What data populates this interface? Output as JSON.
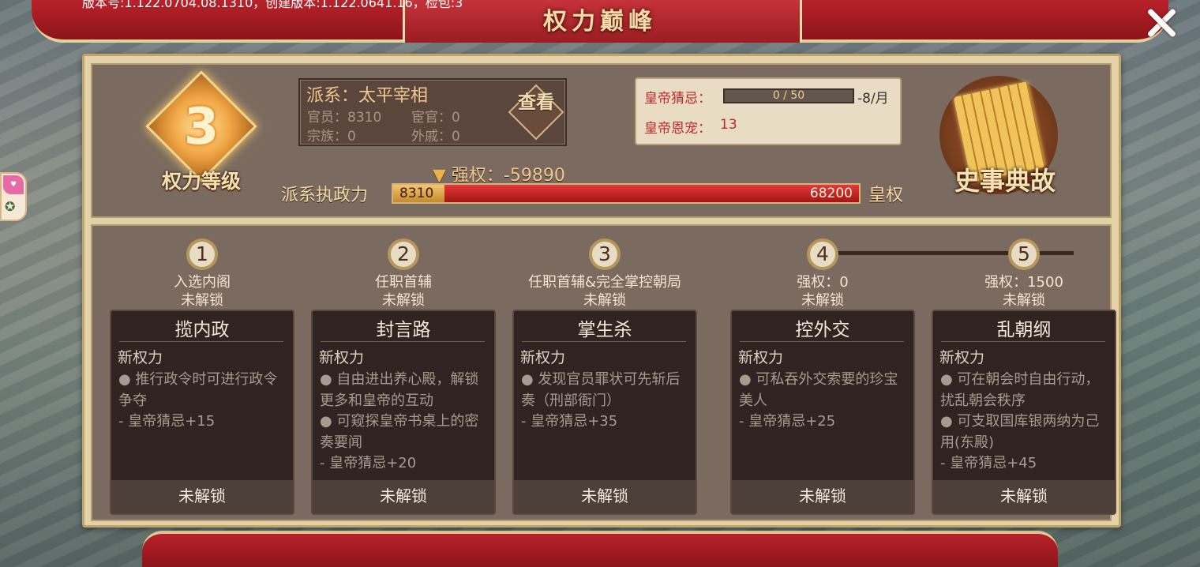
{
  "header": {
    "title": "权力巅峰",
    "version_text": "版本号:1.122.0704.08.1310，创建版本:1.122.0641.16，检包:3"
  },
  "level": {
    "number": "3",
    "label": "权力等级"
  },
  "faction": {
    "name": "派系：太平宰相",
    "officials": "官员：8310",
    "eunuchs": "宦官：0",
    "clan": "宗族：0",
    "relatives": "外戚：0",
    "view_button": "查看"
  },
  "emperor": {
    "suspicion_label": "皇帝猜忌：",
    "suspicion_value": "0 / 50",
    "suspicion_fraction": 0,
    "suspicion_rate": "-8/月",
    "favor_label": "皇帝恩宠：",
    "favor_value": "13"
  },
  "history_button": "史事典故",
  "power": {
    "strong_text": "强权：-59890",
    "faction_power_label": "派系执政力",
    "faction_value": "8310",
    "imperial_value": "68200",
    "imperial_label": "皇权",
    "faction_fraction": 0.11
  },
  "milestones": [
    {
      "index": "1",
      "req1": "入选内阁",
      "req2": "未解锁",
      "title": "揽内政",
      "new_power": "新权力",
      "desc": [
        "● 推行政令时可进行政令争夺",
        "-  皇帝猜忌+15"
      ],
      "button": "未解锁"
    },
    {
      "index": "2",
      "req1": "任职首辅",
      "req2": "未解锁",
      "title": "封言路",
      "new_power": "新权力",
      "desc": [
        "● 自由进出养心殿，解锁更多和皇帝的互动",
        "● 可窥探皇帝书桌上的密奏要闻",
        "-  皇帝猜忌+20"
      ],
      "button": "未解锁"
    },
    {
      "index": "3",
      "req1": "任职首辅&完全掌控朝局",
      "req2": "未解锁",
      "title": "掌生杀",
      "new_power": "新权力",
      "desc": [
        "● 发现官员罪状可先斩后奏（刑部衙门）",
        "-  皇帝猜忌+35"
      ],
      "button": "未解锁"
    },
    {
      "index": "4",
      "req1": "强权：0",
      "req2": "未解锁",
      "title": "控外交",
      "new_power": "新权力",
      "desc": [
        "● 可私吞外交索要的珍宝美人",
        "-  皇帝猜忌+25"
      ],
      "button": "未解锁"
    },
    {
      "index": "5",
      "req1": "强权：1500",
      "req2": "未解锁",
      "title": "乱朝纲",
      "new_power": "新权力",
      "desc": [
        "● 可在朝会时自由行动，扰乱朝会秩序",
        "● 可支取国库银两纳为己用(东殿)",
        "-  皇帝猜忌+45"
      ],
      "button": "未解锁"
    }
  ],
  "colors": {
    "accent": "#c0272d",
    "gold": "#f0c78d",
    "card_bg": "#2f2421"
  }
}
